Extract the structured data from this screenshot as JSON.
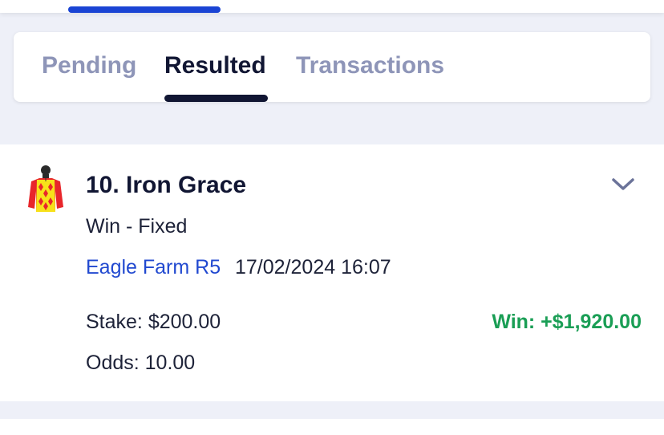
{
  "tabs": {
    "pending": "Pending",
    "resulted": "Resulted",
    "transactions": "Transactions",
    "active": "Resulted"
  },
  "bet": {
    "runner": "10. Iron Grace",
    "bet_type": "Win - Fixed",
    "race": "Eagle Farm R5",
    "datetime": "17/02/2024 16:07",
    "stake": "Stake: $200.00",
    "odds": "Odds: 10.00",
    "result": "Win: +$1,920.00",
    "silks_icon": "jockey-silks-icon",
    "expand_icon": "chevron-down-icon"
  },
  "colors": {
    "accent_blue": "#1a44d4",
    "link_blue": "#2149d0",
    "win_green": "#1a9e55",
    "text_dark": "#111633",
    "tab_inactive": "#8e95b8",
    "page_bg": "#eef0f8"
  }
}
